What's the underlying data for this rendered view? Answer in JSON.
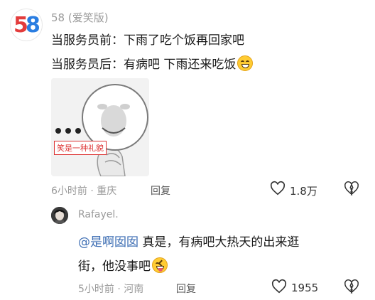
{
  "comment": {
    "username": "58 (爱笑版)",
    "line1": "当服务员前：下雨了吃个饭再回家吧",
    "line2": "当服务员后：有病吧 下雨还来吃饭",
    "meme_caption": "笑是一种礼貌",
    "time": "6小时前",
    "location": "重庆",
    "reply_label": "回复",
    "likes": "1.8万"
  },
  "reply": {
    "username": "Rafayel.",
    "mention": "@是啊囡囡",
    "text_part1": " 真是，有病吧大热天的出来逛",
    "text_part2": "街，他没事吧",
    "time": "5小时前",
    "location": "河南",
    "reply_label": "回复",
    "likes": "1955"
  },
  "icons": {
    "avatar_brand_digits": "58"
  }
}
